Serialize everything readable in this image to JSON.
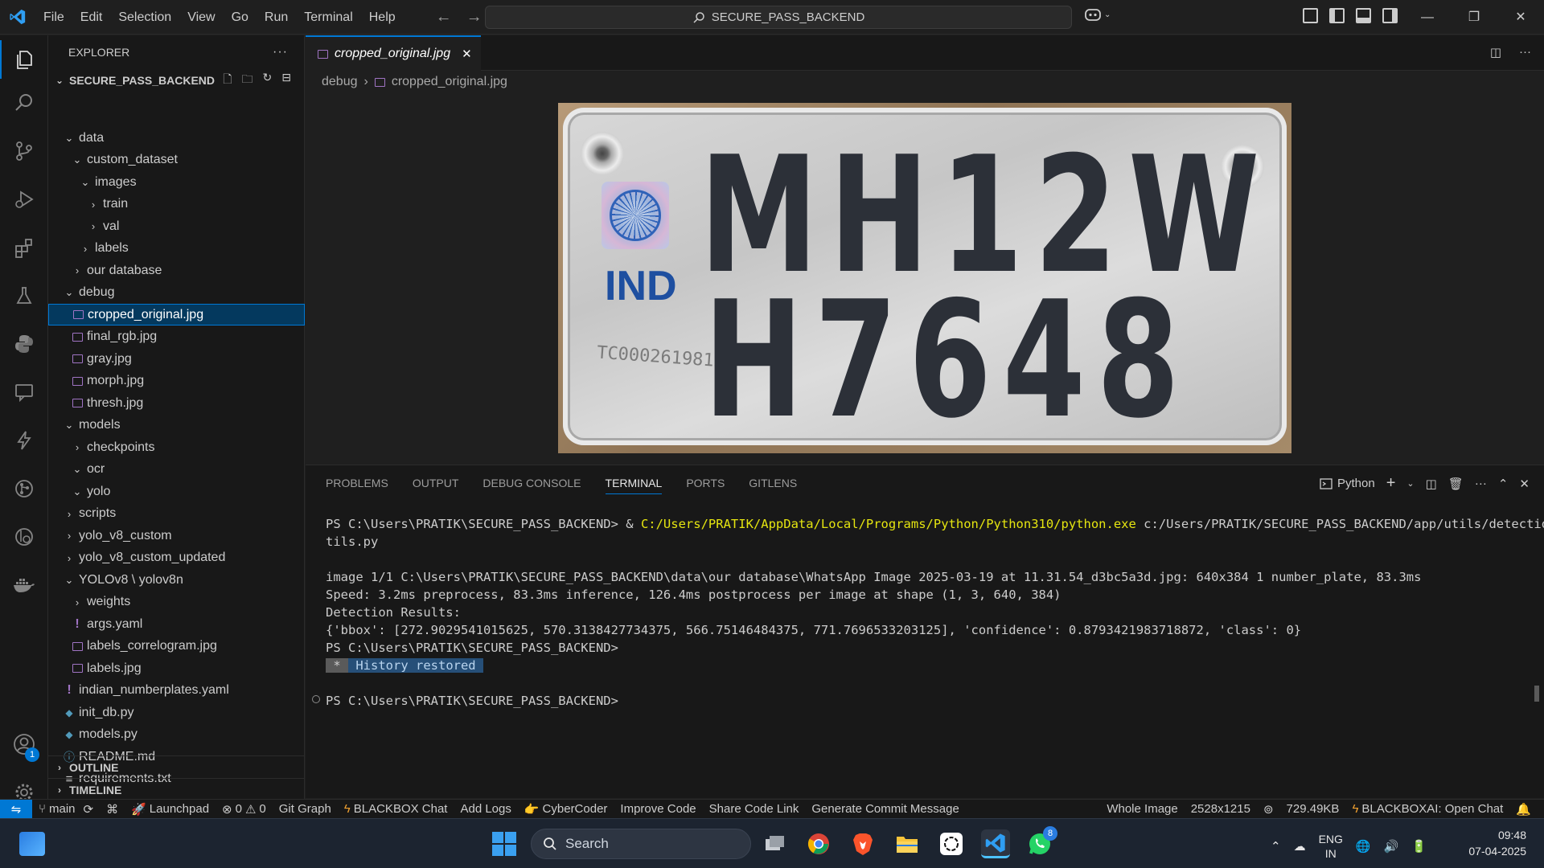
{
  "window": {
    "menu": [
      "File",
      "Edit",
      "Selection",
      "View",
      "Go",
      "Run",
      "Terminal",
      "Help"
    ],
    "search_text": "SECURE_PASS_BACKEND"
  },
  "colors": {
    "accent": "#0078d4",
    "selection": "#04395e",
    "terminal_yellow": "#e5e510",
    "image_icon": "#a074c4"
  },
  "activity_bar": {
    "items": [
      "files-icon",
      "search-icon",
      "source-control-icon",
      "run-debug-icon",
      "extensions-icon",
      "testing-icon",
      "python-icon",
      "remote-explorer-icon",
      "lightning-icon",
      "git-graph-icon",
      "blackbox-icon",
      "docker-icon"
    ],
    "accounts_badge": "1"
  },
  "sidebar": {
    "title": "EXPLORER",
    "more": "···",
    "root": "SECURE_PASS_BACKEND",
    "tree": [
      {
        "label": "data",
        "kind": "folder-open"
      },
      {
        "label": "custom_dataset",
        "kind": "folder-open"
      },
      {
        "label": "images",
        "kind": "folder-open"
      },
      {
        "label": "train",
        "kind": "folder"
      },
      {
        "label": "val",
        "kind": "folder"
      },
      {
        "label": "labels",
        "kind": "folder"
      },
      {
        "label": "our database",
        "kind": "folder"
      },
      {
        "label": "debug",
        "kind": "folder-open"
      },
      {
        "label": "cropped_original.jpg",
        "kind": "image",
        "selected": true
      },
      {
        "label": "final_rgb.jpg",
        "kind": "image"
      },
      {
        "label": "gray.jpg",
        "kind": "image"
      },
      {
        "label": "morph.jpg",
        "kind": "image"
      },
      {
        "label": "thresh.jpg",
        "kind": "image"
      },
      {
        "label": "models",
        "kind": "folder-open"
      },
      {
        "label": "checkpoints",
        "kind": "folder"
      },
      {
        "label": "ocr",
        "kind": "folder-open"
      },
      {
        "label": "yolo",
        "kind": "folder-open"
      },
      {
        "label": "scripts",
        "kind": "folder"
      },
      {
        "label": "yolo_v8_custom",
        "kind": "folder"
      },
      {
        "label": "yolo_v8_custom_updated",
        "kind": "folder"
      },
      {
        "label": "YOLOv8 \\ yolov8n",
        "kind": "folder-open"
      },
      {
        "label": "weights",
        "kind": "folder"
      },
      {
        "label": "args.yaml",
        "kind": "yaml"
      },
      {
        "label": "labels_correlogram.jpg",
        "kind": "image"
      },
      {
        "label": "labels.jpg",
        "kind": "image"
      },
      {
        "label": "indian_numberplates.yaml",
        "kind": "yaml"
      },
      {
        "label": "init_db.py",
        "kind": "python"
      },
      {
        "label": "models.py",
        "kind": "python"
      },
      {
        "label": "README.md",
        "kind": "info"
      },
      {
        "label": "requirements.txt",
        "kind": "text"
      }
    ],
    "outline": "OUTLINE",
    "timeline": "TIMELINE"
  },
  "editor": {
    "tab_label": "cropped_original.jpg",
    "breadcrumb": [
      "debug",
      "cropped_original.jpg"
    ],
    "plate": {
      "line1": "MH12W",
      "line2": "H7648",
      "country": "IND",
      "serial": "TC0002619812"
    }
  },
  "panel": {
    "tabs": [
      "PROBLEMS",
      "OUTPUT",
      "DEBUG CONSOLE",
      "TERMINAL",
      "PORTS",
      "GITLENS"
    ],
    "active_tab": "TERMINAL",
    "shell_label": "Python",
    "terminal": {
      "prompt1": "PS C:\\Users\\PRATIK\\SECURE_PASS_BACKEND> & ",
      "python_exe": "C:/Users/PRATIK/AppData/Local/Programs/Python/Python310/python.exe",
      "script_a": " c:/Users/PRATIK/SECURE_PASS_BACKEND/app/utils/detection_u",
      "script_b": "tils.py",
      "image_line": "image 1/1 C:\\Users\\PRATIK\\SECURE_PASS_BACKEND\\data\\our database\\WhatsApp Image 2025-03-19 at 11.31.54_d3bc5a3d.jpg: 640x384 1 number_plate, 83.3ms",
      "speed_line": "Speed: 3.2ms preprocess, 83.3ms inference, 126.4ms postprocess per image at shape (1, 3, 640, 384)",
      "results_line": "Detection Results:",
      "dict_line": "{'bbox': [272.9029541015625, 570.3138427734375, 566.75146484375, 771.7696533203125], 'confidence': 0.8793421983718872, 'class': 0}",
      "prompt2": "PS C:\\Users\\PRATIK\\SECURE_PASS_BACKEND>",
      "history_star": " * ",
      "history_text": " History restored ",
      "prompt3": "PS C:\\Users\\PRATIK\\SECURE_PASS_BACKEND>"
    }
  },
  "statusbar": {
    "branch": "main",
    "launchpad": "Launchpad",
    "errors": "0",
    "warnings": "0",
    "git_graph": "Git Graph",
    "blackbox_chat": "BLACKBOX Chat",
    "add_logs": "Add Logs",
    "cybercoder": "CyberCoder",
    "improve_code": "Improve Code",
    "share_code_link": "Share Code Link",
    "generate_commit": "Generate Commit Message",
    "whole_image": "Whole Image",
    "dimensions": "2528x1215",
    "file_size": "729.49KB",
    "blackboxai": "BLACKBOXAI: Open Chat"
  },
  "taskbar": {
    "search_placeholder": "Search",
    "whatsapp_badge": "8",
    "lang_top": "ENG",
    "lang_bottom": "IN",
    "time": "09:48",
    "date": "07-04-2025"
  }
}
